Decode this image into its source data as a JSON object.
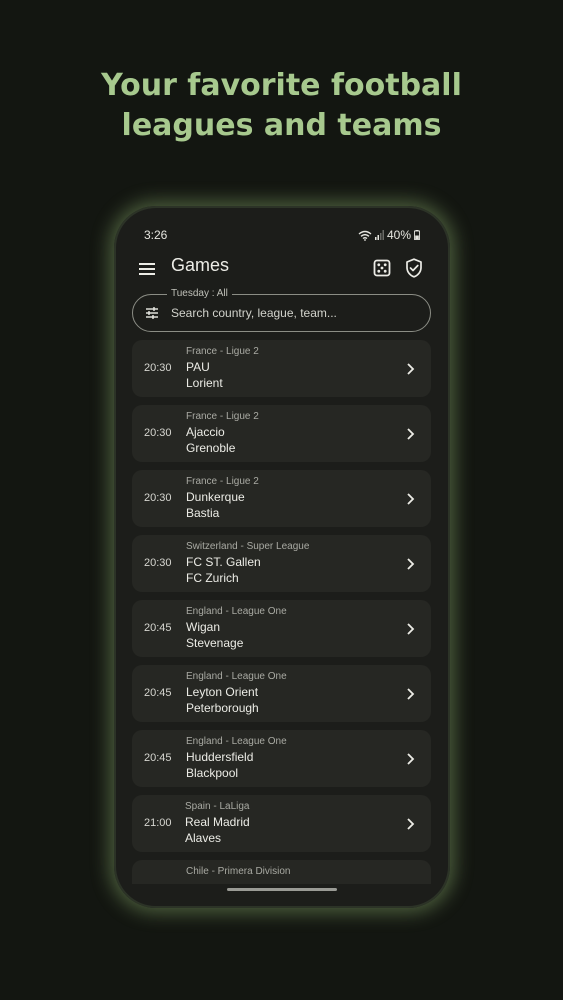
{
  "headline": {
    "line1": "Your favorite football",
    "line2": "leagues and teams"
  },
  "colors": {
    "accent": "#a7c98e",
    "background": "#131611",
    "card": "#262723"
  },
  "status_bar": {
    "time": "3:26",
    "battery": "40%"
  },
  "app_bar": {
    "title": "Games",
    "icons": [
      "menu-icon",
      "dice-icon",
      "shield-check-icon"
    ]
  },
  "search": {
    "legend": "Tuesday : All",
    "placeholder": "Search country, league, team..."
  },
  "games": [
    {
      "time": "20:30",
      "league": "France - Ligue 2",
      "home": "PAU",
      "away": "Lorient"
    },
    {
      "time": "20:30",
      "league": "France - Ligue 2",
      "home": "Ajaccio",
      "away": "Grenoble"
    },
    {
      "time": "20:30",
      "league": "France - Ligue 2",
      "home": "Dunkerque",
      "away": "Bastia"
    },
    {
      "time": "20:30",
      "league": "Switzerland - Super League",
      "home": "FC ST. Gallen",
      "away": "FC Zurich"
    },
    {
      "time": "20:45",
      "league": "England - League One",
      "home": "Wigan",
      "away": "Stevenage"
    },
    {
      "time": "20:45",
      "league": "England - League One",
      "home": "Leyton Orient",
      "away": "Peterborough"
    },
    {
      "time": "20:45",
      "league": "England - League One",
      "home": "Huddersfield",
      "away": "Blackpool"
    },
    {
      "time": "21:00",
      "league": "Spain - LaLiga",
      "home": "Real Madrid",
      "away": "Alaves"
    },
    {
      "time": "",
      "league": "Chile - Primera Division",
      "home": "",
      "away": ""
    }
  ]
}
